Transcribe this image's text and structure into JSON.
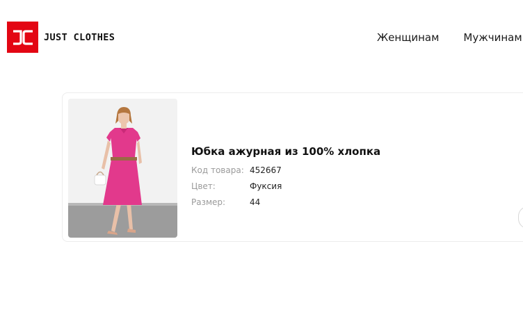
{
  "header": {
    "logo_mark": "JC",
    "logo_text": "JUST CLOTHES",
    "nav": [
      {
        "label": "Женщинам"
      },
      {
        "label": "Мужчинам"
      }
    ]
  },
  "product": {
    "title": "Юбка ажурная из 100% хлопка",
    "specs": [
      {
        "label": "Код товара:",
        "value": "452667"
      },
      {
        "label": "Цвет:",
        "value": "Фуксия"
      },
      {
        "label": "Размер:",
        "value": "44"
      }
    ]
  },
  "colors": {
    "brand": "#e30613",
    "product": "#e2398c"
  }
}
